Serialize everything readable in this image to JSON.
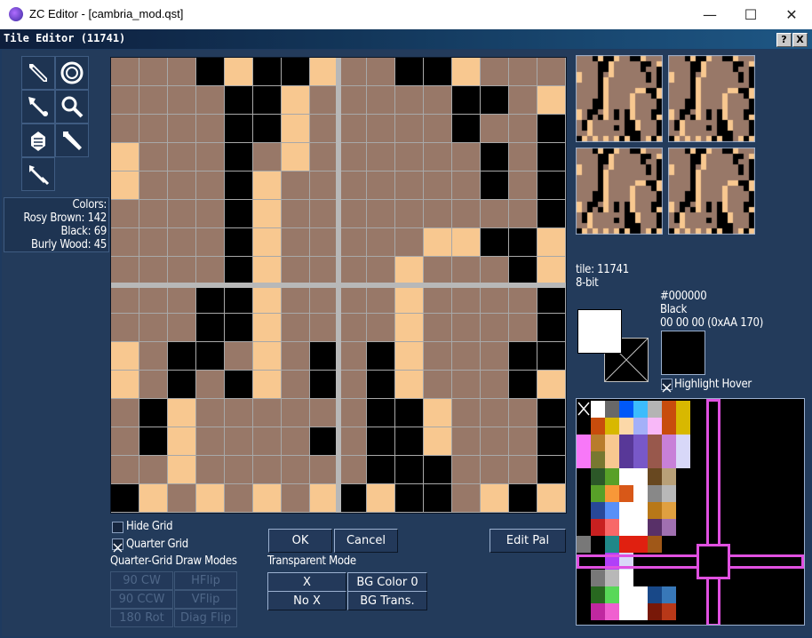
{
  "window": {
    "title": "ZC Editor - [cambria_mod.qst]",
    "minimize_glyph": "—",
    "maximize_glyph": "☐",
    "close_glyph": "✕"
  },
  "dialog": {
    "title": "Tile Editor (11741)",
    "help_label": "?",
    "close_label": "X"
  },
  "tools": [
    {
      "name": "pencil-tool-icon"
    },
    {
      "name": "ring-tool-icon"
    },
    {
      "name": "eyedropper-tool-icon"
    },
    {
      "name": "magnifier-tool-icon"
    },
    {
      "name": "fill-tool-icon"
    },
    {
      "name": "line-tool-icon"
    },
    {
      "name": "select-tool-icon"
    }
  ],
  "colors_panel": {
    "heading": "Colors:",
    "rows": [
      "Rosy Brown: 142",
      "Black: 69",
      "Burly Wood: 45"
    ]
  },
  "palette_colors": {
    "rosy": "#987868",
    "black": "#000000",
    "wood": "#f8c890",
    "grid": "#a8a8a8",
    "quarter": "#b8b8b8"
  },
  "tile_grid": [
    "RRRBWBBWRRBBWRRR",
    "RRRRBBWRRRRRBBRW",
    "RRRRBBWRRRRRBRRB",
    "WRRRBRWRRRRRRBRB",
    "WRRRBWRRRRRRRBRB",
    "RRRRBWRRRRRRRRRB",
    "RRRRBWRRRRRWWBBW",
    "RRRRBWRRRRWRRRBW",
    "RRRBBWRRRRWRRRRB",
    "RRRBBWRRRRWRRRRB",
    "WRBBRWRBRBWRRRBB",
    "WRBRBWRBRBWRRRBW",
    "RBWRRRRRRBBWRRRB",
    "RBWRRRRBRBBWRRRB",
    "RRWRRRRRRBBBRRRB",
    "BWRWRWRWBWBBRWBW"
  ],
  "tile_info": {
    "line1": "tile: 11741",
    "line2": "8-bit"
  },
  "color_info": {
    "hex": "#000000",
    "name": "Black",
    "values": "00 00 00  (0xAA 170)"
  },
  "options": {
    "hide_grid": "Hide Grid",
    "quarter_grid": "Quarter Grid",
    "quarter_grid_modes": "Quarter-Grid Draw Modes",
    "transparent_mode": "Transparent Mode",
    "highlight_hover": "Highlight Hover"
  },
  "buttons": {
    "ok": "OK",
    "cancel": "Cancel",
    "edit_pal": "Edit Pal",
    "cw90": "90 CW",
    "ccw90": "90 CCW",
    "rot180": "180 Rot",
    "hflip": "HFlip",
    "vflip": "VFlip",
    "diag_flip": "Diag Flip",
    "x": "X",
    "no_x": "No X",
    "bg_color0": "BG Color 0",
    "bg_trans": "BG Trans."
  },
  "palette_rows": [
    [
      "#000000",
      "#ffffff",
      "#686868",
      "#0058f8",
      "#3cbcfc",
      "#b4b4b4",
      "#c84c0c",
      "#d8b800",
      "#000000",
      "#000000",
      "#000000",
      "#000000",
      "#000000",
      "#000000",
      "#000000",
      "#000000"
    ],
    [
      "#000000",
      "#c84c0c",
      "#d8b800",
      "#fcd8a8",
      "#a4b0f8",
      "#f8b8f8",
      "#c84c0c",
      "#d8b800",
      "#000000",
      "#000000",
      "#000000",
      "#000000",
      "#000000",
      "#000000",
      "#000000",
      "#000000"
    ],
    [
      "#f878f8",
      "#b87c2c",
      "#f8c890",
      "#583898",
      "#7858c8",
      "#98584c",
      "#c880d8",
      "#d8d8f8",
      "#000000",
      "#000000",
      "#000000",
      "#000000",
      "#000000",
      "#000000",
      "#000000",
      "#000000"
    ],
    [
      "#f878f8",
      "#787830",
      "#f8c890",
      "#583898",
      "#7858c8",
      "#98584c",
      "#c880d8",
      "#d8d8f8",
      "#000000",
      "#000000",
      "#000000",
      "#000000",
      "#000000",
      "#000000",
      "#000000",
      "#000000"
    ],
    [
      "#000000",
      "#2c5828",
      "#58a028",
      "#ffffff",
      "#ffffff",
      "#684820",
      "#b8a078",
      "#000000",
      "#000000",
      "#000000",
      "#000000",
      "#000000",
      "#000000",
      "#000000",
      "#000000",
      "#000000"
    ],
    [
      "#000000",
      "#58a028",
      "#f89838",
      "#d85818",
      "#ffffff",
      "#888888",
      "#b8b8b8",
      "#000000",
      "#000000",
      "#000000",
      "#000000",
      "#000000",
      "#000000",
      "#000000",
      "#000000",
      "#000000"
    ],
    [
      "#000000",
      "#284898",
      "#5890f8",
      "#ffffff",
      "#ffffff",
      "#b87818",
      "#e0a040",
      "#000000",
      "#000000",
      "#000000",
      "#000000",
      "#000000",
      "#000000",
      "#000000",
      "#000000",
      "#000000"
    ],
    [
      "#000000",
      "#c82020",
      "#f86868",
      "#ffffff",
      "#ffffff",
      "#583068",
      "#a070b0",
      "#000000",
      "#000000",
      "#000000",
      "#000000",
      "#000000",
      "#000000",
      "#000000",
      "#000000",
      "#000000"
    ],
    [
      "#787878",
      "#000000",
      "#208888",
      "#e02010",
      "#e02010",
      "#a05818",
      "#000000",
      "#000000",
      "#000000",
      "#000000",
      "#000000",
      "#000000",
      "#000000",
      "#000000",
      "#000000",
      "#000000"
    ],
    [
      "#000000",
      "#000000",
      "#b040f8",
      "#d8d8f8",
      "#000000",
      "#000000",
      "#000000",
      "#000000",
      "#000000",
      "#000000",
      "#000000",
      "#000000",
      "#000000",
      "#000000",
      "#000000",
      "#000000"
    ],
    [
      "#000000",
      "#787878",
      "#b8b8b8",
      "#ffffff",
      "#000000",
      "#000000",
      "#000000",
      "#000000",
      "#000000",
      "#000000",
      "#000000",
      "#000000",
      "#000000",
      "#000000",
      "#000000",
      "#000000"
    ],
    [
      "#000000",
      "#286820",
      "#58d858",
      "#ffffff",
      "#ffffff",
      "#184888",
      "#3878b8",
      "#000000",
      "#000000",
      "#000000",
      "#000000",
      "#000000",
      "#000000",
      "#000000",
      "#000000",
      "#000000"
    ],
    [
      "#000000",
      "#c028a0",
      "#f060d0",
      "#ffffff",
      "#ffffff",
      "#781808",
      "#b83818",
      "#000000",
      "#000000",
      "#000000",
      "#000000",
      "#000000",
      "#000000",
      "#000000",
      "#000000",
      "#000000"
    ]
  ],
  "palette_highlight": {
    "accent": "#e050e0",
    "row": 9,
    "col": 10
  }
}
